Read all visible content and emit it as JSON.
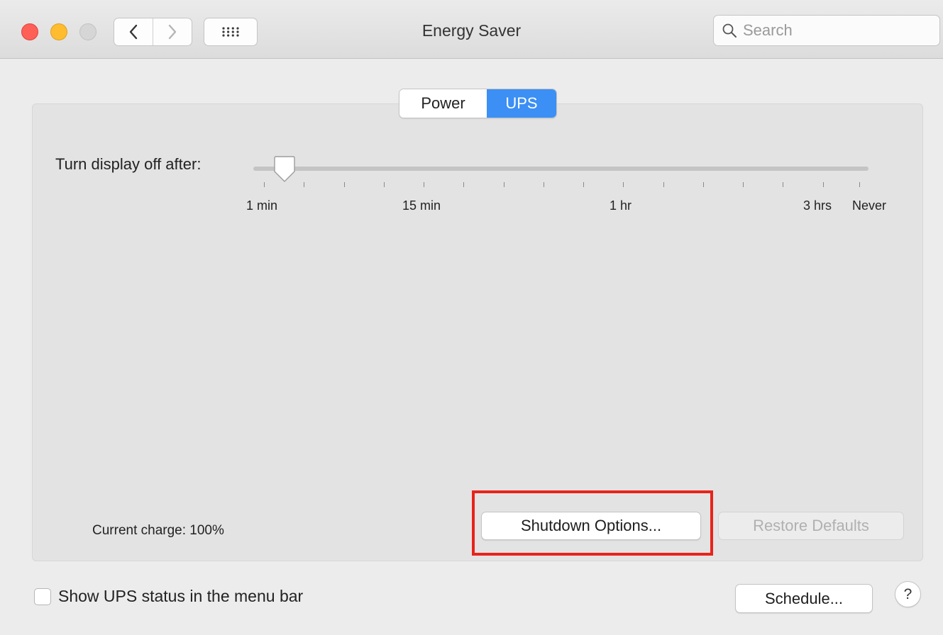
{
  "window": {
    "title": "Energy Saver"
  },
  "toolbar": {
    "search_placeholder": "Search"
  },
  "tabs": [
    {
      "label": "Power",
      "selected": false
    },
    {
      "label": "UPS",
      "selected": true
    }
  ],
  "slider": {
    "label": "Turn display off after:",
    "value": "1 min",
    "tick_labels": [
      "1 min",
      "15 min",
      "1 hr",
      "3 hrs",
      "Never"
    ]
  },
  "status": {
    "charge_text": "Current charge: 100%"
  },
  "buttons": {
    "shutdown_options": "Shutdown Options...",
    "restore_defaults": "Restore Defaults",
    "schedule": "Schedule...",
    "help": "?"
  },
  "menu_bar_option": {
    "label": "Show UPS status in the menu bar",
    "checked": false
  },
  "colors": {
    "accent": "#3b8ff5",
    "highlight": "#e8231b",
    "close": "#fe5f57",
    "minimize": "#febc2e"
  }
}
